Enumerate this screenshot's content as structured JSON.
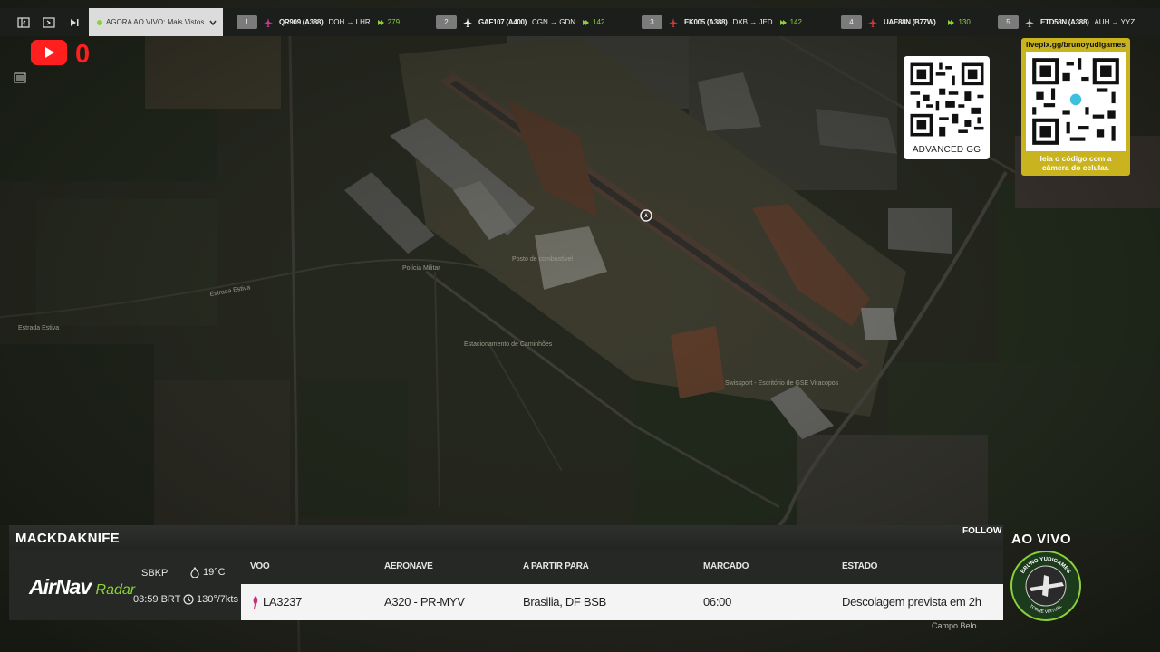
{
  "toolbar": {
    "live_label": "AGORA AO VIVO: Mais Vistos",
    "flights": [
      {
        "rank": "1",
        "callsign": "QR909 (A388)",
        "route": "DOH → LHR",
        "viewers": "279"
      },
      {
        "rank": "2",
        "callsign": "GAF107 (A400)",
        "route": "CGN → GDN",
        "viewers": "142"
      },
      {
        "rank": "3",
        "callsign": "EK005 (A388)",
        "route": "DXB → JED",
        "viewers": "142"
      },
      {
        "rank": "4",
        "callsign": "UAE88N (B77W)",
        "route": "",
        "viewers": "130"
      },
      {
        "rank": "5",
        "callsign": "ETD58N (A388)",
        "route": "AUH → YYZ",
        "viewers": ""
      }
    ]
  },
  "youtube": {
    "count": "0"
  },
  "qr_left": {
    "label": "ADVANCED GG"
  },
  "qr_right": {
    "url": "livepix.gg/brunoyudigames",
    "caption_1": "leia o código com a",
    "caption_2": "câmera do celular."
  },
  "map_labels": {
    "road_1": "Estrada Estiva",
    "road_2": "Estrada Estiva",
    "parking": "Estacionamento de Caminhões",
    "terminal": "Posto de combustível",
    "police": "Polícia Militar",
    "swissport": "Swissport - Escritório de GSE Viracopos",
    "campo_belo": "Campo Belo"
  },
  "panel": {
    "username": "MACKDAKNIFE",
    "follow": "FOLLOW",
    "logo_main": "AirNav",
    "logo_sub": "Radar",
    "airport": "SBKP",
    "time": "03:59 BRT",
    "temperature": "19°C",
    "wind": "130°/7kts",
    "columns": {
      "flight": "VOO",
      "aircraft": "AERONAVE",
      "destination": "A PARTIR PARA",
      "scheduled": "MARCADO",
      "status": "ESTADO"
    },
    "row": {
      "flight": "LA3237",
      "aircraft": "A320 - PR-MYV",
      "destination": "Brasilia, DF BSB",
      "scheduled": "06:00",
      "status": "Descolagem prevista em 2h"
    }
  },
  "ao_vivo": "AO VIVO",
  "badge": {
    "top_text": "BRUNO YUDIGAMES",
    "bottom_text": "TORRE VIRTUAL"
  },
  "colors": {
    "accent_green": "#8bd13a",
    "youtube_red": "#ff1f1f",
    "qr_gold": "#c9b41f"
  }
}
